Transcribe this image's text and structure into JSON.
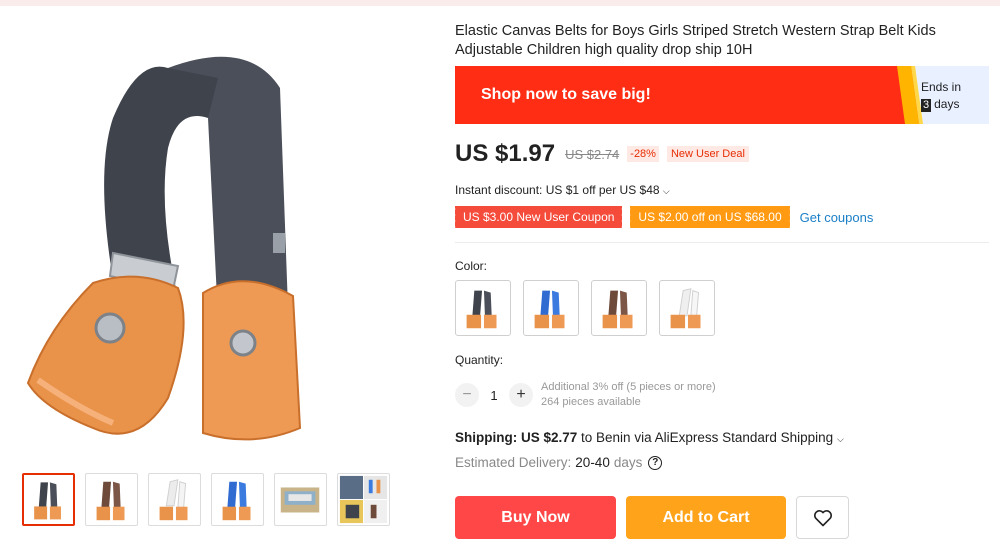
{
  "product": {
    "title": "Elastic Canvas Belts for Boys Girls Striped Stretch Western Strap Belt Kids Adjustable Children high quality drop ship 10H"
  },
  "gallery": {
    "thumbnails": [
      "dark-gray",
      "brown",
      "white",
      "blue",
      "packaging",
      "collage"
    ],
    "selected_index": 0
  },
  "promo": {
    "text": "Shop now to save big!",
    "ends_in_label": "Ends in",
    "days_number": "3",
    "days_label": "days"
  },
  "price": {
    "current": "US $1.97",
    "original": "US $2.74",
    "discount": "-28%",
    "deal_label": "New User Deal"
  },
  "instant_discount": "Instant discount: US $1 off per US $48",
  "coupons": {
    "new_user": "US $3.00 New User Coupon",
    "store": "US $2.00 off on US $68.00",
    "get_label": "Get coupons"
  },
  "color": {
    "label": "Color:",
    "options": [
      "dark-gray",
      "blue",
      "brown",
      "white"
    ]
  },
  "quantity": {
    "label": "Quantity:",
    "minus": "−",
    "value": "1",
    "plus": "+",
    "additional": "Additional 3% off (5 pieces or more)",
    "available": "264 pieces available"
  },
  "shipping": {
    "label": "Shipping: US $2.77",
    "destination": " to Benin via AliExpress Standard Shipping",
    "est_label": "Estimated Delivery:",
    "est_value": "20-40",
    "est_unit": "days"
  },
  "actions": {
    "buy_now": "Buy Now",
    "add_to_cart": "Add to Cart"
  },
  "icons": {
    "chevron": "chevron-down-icon",
    "help": "question-circle-icon",
    "wishlist": "heart-icon"
  },
  "colors": {
    "accent_red": "#ff4747",
    "accent_orange": "#ffa31a",
    "promo_red": "#ff2d14",
    "link_blue": "#1a7fc7"
  }
}
